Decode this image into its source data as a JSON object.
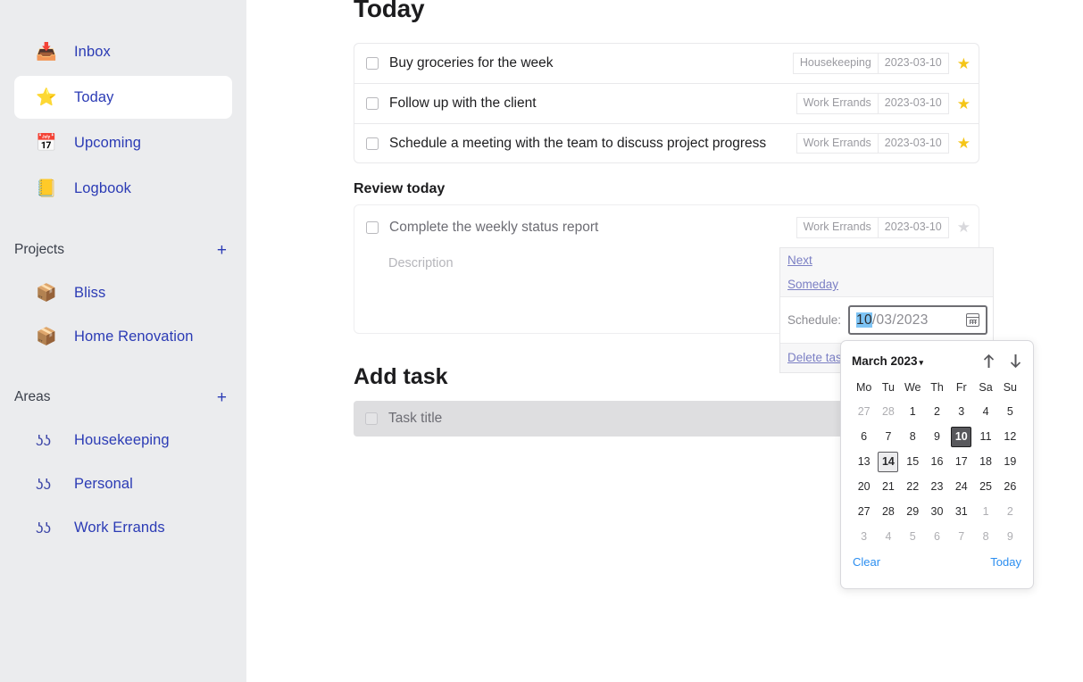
{
  "sidebar": {
    "nav": [
      {
        "label": "Inbox",
        "icon": "inbox-tray-icon",
        "glyph": "📥",
        "active": false
      },
      {
        "label": "Today",
        "icon": "star-icon",
        "glyph": "⭐",
        "active": true
      },
      {
        "label": "Upcoming",
        "icon": "calendar-icon",
        "glyph": "📅",
        "active": false
      },
      {
        "label": "Logbook",
        "icon": "notebook-icon",
        "glyph": "📒",
        "active": false
      }
    ],
    "projects": {
      "title": "Projects",
      "add_label": "+",
      "items": [
        {
          "label": "Bliss",
          "icon": "package-icon",
          "glyph": "📦"
        },
        {
          "label": "Home Renovation",
          "icon": "package-icon",
          "glyph": "📦"
        }
      ]
    },
    "areas": {
      "title": "Areas",
      "add_label": "+",
      "items": [
        {
          "label": "Housekeeping",
          "icon": "goggles-icon",
          "glyph": "ʖʖ"
        },
        {
          "label": "Personal",
          "icon": "goggles-icon",
          "glyph": "ʖʖ"
        },
        {
          "label": "Work Errands",
          "icon": "goggles-icon",
          "glyph": "ʖʖ"
        }
      ]
    }
  },
  "main": {
    "page_title": "Today",
    "tasks": [
      {
        "title": "Buy groceries for the week",
        "area": "Housekeeping",
        "date": "2023-03-10",
        "starred": true
      },
      {
        "title": "Follow up with the client",
        "area": "Work Errands",
        "date": "2023-03-10",
        "starred": true
      },
      {
        "title": "Schedule a meeting with the team to discuss project progress",
        "area": "Work Errands",
        "date": "2023-03-10",
        "starred": true
      }
    ],
    "review_section_title": "Review today",
    "review_task": {
      "title": "Complete the weekly status report",
      "area": "Work Errands",
      "date": "2023-03-10",
      "description_placeholder": "Description"
    },
    "add_task": {
      "heading": "Add task",
      "placeholder": "Task title"
    }
  },
  "schedule_popup": {
    "next_label": "Next",
    "someday_label": "Someday",
    "schedule_label": "Schedule:",
    "date_value_selected": "10",
    "date_value_rest": "/03/2023",
    "calendar_button_icon": "calendar-picker-icon",
    "delete_label": "Delete task"
  },
  "calendar": {
    "month_label": "March 2023",
    "caret": "▾",
    "prev_icon": "arrow-up-icon",
    "next_icon": "arrow-down-icon",
    "weekdays": [
      "Mo",
      "Tu",
      "We",
      "Th",
      "Fr",
      "Sa",
      "Su"
    ],
    "weeks": [
      [
        {
          "d": "27",
          "o": true
        },
        {
          "d": "28",
          "o": true
        },
        {
          "d": "1"
        },
        {
          "d": "2"
        },
        {
          "d": "3"
        },
        {
          "d": "4"
        },
        {
          "d": "5"
        }
      ],
      [
        {
          "d": "6"
        },
        {
          "d": "7"
        },
        {
          "d": "8"
        },
        {
          "d": "9"
        },
        {
          "d": "10",
          "sel": true
        },
        {
          "d": "11"
        },
        {
          "d": "12"
        }
      ],
      [
        {
          "d": "13"
        },
        {
          "d": "14",
          "today": true
        },
        {
          "d": "15"
        },
        {
          "d": "16"
        },
        {
          "d": "17"
        },
        {
          "d": "18"
        },
        {
          "d": "19"
        }
      ],
      [
        {
          "d": "20"
        },
        {
          "d": "21"
        },
        {
          "d": "22"
        },
        {
          "d": "23"
        },
        {
          "d": "24"
        },
        {
          "d": "25"
        },
        {
          "d": "26"
        }
      ],
      [
        {
          "d": "27"
        },
        {
          "d": "28"
        },
        {
          "d": "29"
        },
        {
          "d": "30"
        },
        {
          "d": "31"
        },
        {
          "d": "1",
          "o": true
        },
        {
          "d": "2",
          "o": true
        }
      ],
      [
        {
          "d": "3",
          "o": true
        },
        {
          "d": "4",
          "o": true
        },
        {
          "d": "5",
          "o": true
        },
        {
          "d": "6",
          "o": true
        },
        {
          "d": "7",
          "o": true
        },
        {
          "d": "8",
          "o": true
        },
        {
          "d": "9",
          "o": true
        }
      ]
    ],
    "clear_label": "Clear",
    "today_label": "Today",
    "selected_date": "2023-03-10",
    "today_date": "2023-03-14"
  },
  "colors": {
    "sidebar_bg": "#ebecee",
    "nav_text": "#2b3bb5",
    "star": "#f5c518",
    "link": "#2b8ef0",
    "selection": "#7ec4f5"
  }
}
